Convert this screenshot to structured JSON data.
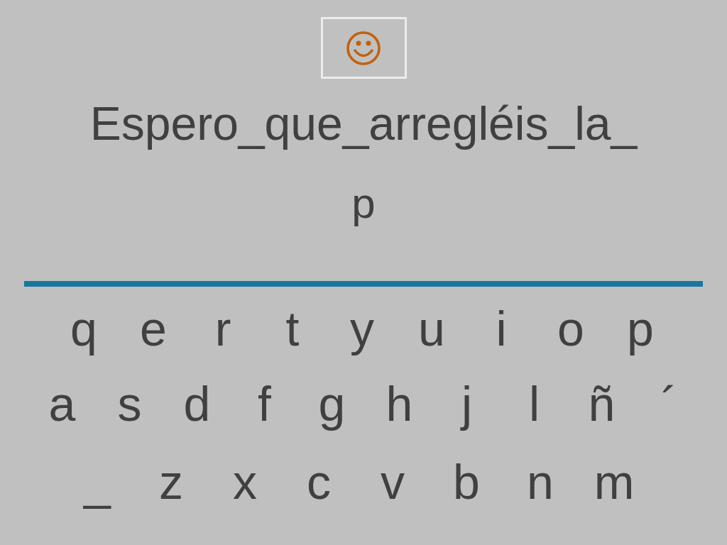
{
  "sentence": "Espero_que_arregléis_la_",
  "answer": "p",
  "keyboard": [
    [
      "q",
      "e",
      "r",
      "t",
      "y",
      "u",
      "i",
      "o",
      "p"
    ],
    [
      "a",
      "s",
      "d",
      "f",
      "g",
      "h",
      "j",
      "l",
      "ñ",
      "´"
    ],
    [
      "_",
      "z",
      "x",
      "c",
      "v",
      "b",
      "n",
      "m"
    ]
  ]
}
